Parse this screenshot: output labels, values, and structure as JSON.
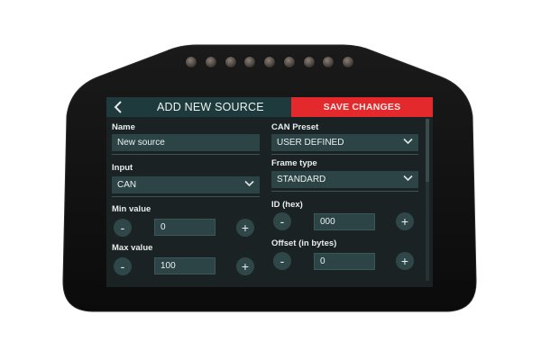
{
  "header": {
    "back_icon": "chevron-left-icon",
    "title": "ADD NEW SOURCE",
    "save_label": "SAVE CHANGES"
  },
  "form": {
    "name": {
      "label": "Name",
      "value": "New source"
    },
    "input": {
      "label": "Input",
      "value": "CAN"
    },
    "min_value": {
      "label": "Min value",
      "value": "0"
    },
    "max_value": {
      "label": "Max value",
      "value": "100"
    },
    "can_preset": {
      "label": "CAN Preset",
      "value": "USER DEFINED"
    },
    "frame_type": {
      "label": "Frame type",
      "value": "STANDARD"
    },
    "id_hex": {
      "label": "ID (hex)",
      "value": "000"
    },
    "offset": {
      "label": "Offset (in bytes)",
      "value": "0"
    }
  },
  "controls": {
    "minus": "-",
    "plus": "+",
    "chevron": "⌄"
  },
  "colors": {
    "save": "#e3292b",
    "header": "#1f3a3c",
    "field": "#2c4446",
    "screen": "#1b2223"
  }
}
